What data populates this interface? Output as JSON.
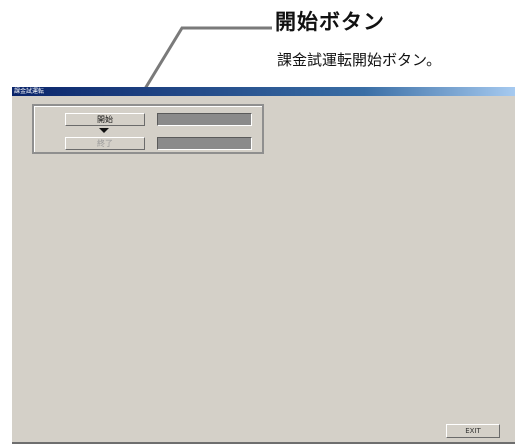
{
  "callout": {
    "title": "開始ボタン",
    "description": "課金試運転開始ボタン。"
  },
  "window": {
    "title": "課金試運転"
  },
  "controls": {
    "start_label": "開始",
    "end_label": "終了",
    "start_value": "",
    "end_value": ""
  },
  "footer": {
    "exit_label": "EXIT"
  }
}
